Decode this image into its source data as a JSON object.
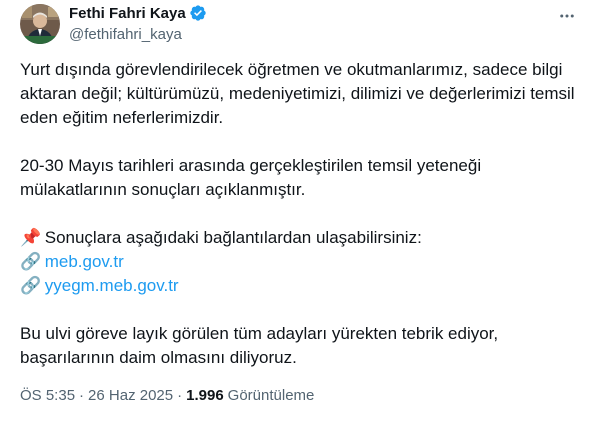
{
  "author": {
    "display_name": "Fethi Fahri Kaya",
    "handle": "@fethifahri_kaya",
    "verified": true
  },
  "tweet": {
    "paragraph_1": "Yurt dışında görevlendirilecek öğretmen ve okutmanlarımız, sadece bilgi aktaran değil; kültürümüzü, medeniyetimizi, dilimizi ve değerlerimizi temsil eden eğitim neferlerimizdir.",
    "paragraph_2": "20-30 Mayıs tarihleri arasında gerçekleştirilen temsil yeteneği mülakatlarının sonuçları açıklanmıştır.",
    "pin_emoji": "📌",
    "links_intro": "Sonuçlara aşağıdaki bağlantılardan ulaşabilirsiniz:",
    "link_emoji": "🔗",
    "link_1": "meb.gov.tr",
    "link_2": "yyegm.meb.gov.tr",
    "paragraph_4": "Bu ulvi göreve layık görülen tüm adayları yürekten tebrik ediyor, başarılarının daim olmasını diliyoruz."
  },
  "meta": {
    "time": "ÖS 5:35",
    "separator": "·",
    "date": "26 Haz 2025",
    "views_count": "1.996",
    "views_label": "Görüntüleme"
  },
  "colors": {
    "link": "#1d9bf0",
    "verified_badge": "#1d9bf0",
    "secondary_text": "#536471",
    "primary_text": "#0f1419"
  }
}
